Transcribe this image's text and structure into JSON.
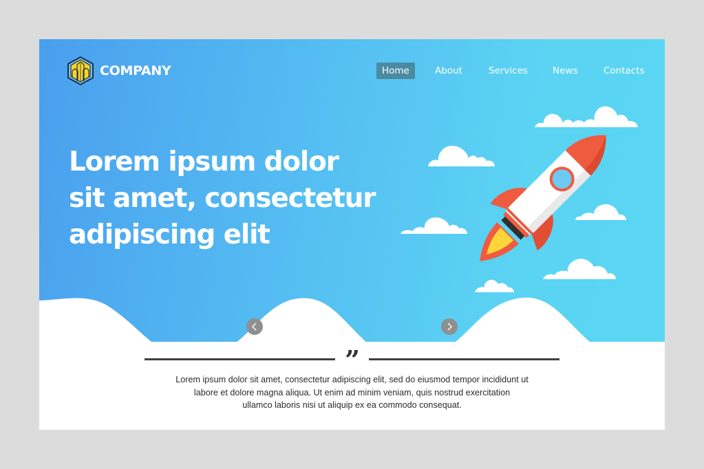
{
  "brand": {
    "name": "COMPANY",
    "logo_icon": "hexagon-buildings-icon",
    "colors": {
      "hero_gradient_start": "#4a9fee",
      "hero_gradient_end": "#5ad6f3",
      "logo_fill": "#f8d52a",
      "rocket_red": "#ef5b3f",
      "flame_yellow": "#fcd53a",
      "nav_active_bg": "#4a8aa3",
      "arrow_button": "#8f8f8f",
      "page_background": "#dcdcdc"
    }
  },
  "nav": {
    "items": [
      {
        "label": "Home",
        "active": true
      },
      {
        "label": "About",
        "active": false
      },
      {
        "label": "Services",
        "active": false
      },
      {
        "label": "News",
        "active": false
      },
      {
        "label": "Contacts",
        "active": false
      }
    ]
  },
  "hero": {
    "headline_lines": [
      "Lorem ipsum dolor",
      "sit amet, consectetur",
      "adipiscing elit"
    ],
    "illustration": "rocket-with-clouds-icon"
  },
  "slider": {
    "prev_icon": "chevron-left-icon",
    "next_icon": "chevron-right-icon"
  },
  "testimonial": {
    "quote_icon": "quote-mark-icon",
    "quote_glyph": "”",
    "text_lines": [
      "Lorem ipsum dolor sit amet, consectetur adipiscing elit, sed do eiusmod tempor incididunt ut",
      "labore et dolore magna aliqua. Ut enim ad minim veniam, quis nostrud exercitation",
      "ullamco laboris nisi ut aliquip ex ea commodo consequat."
    ]
  }
}
